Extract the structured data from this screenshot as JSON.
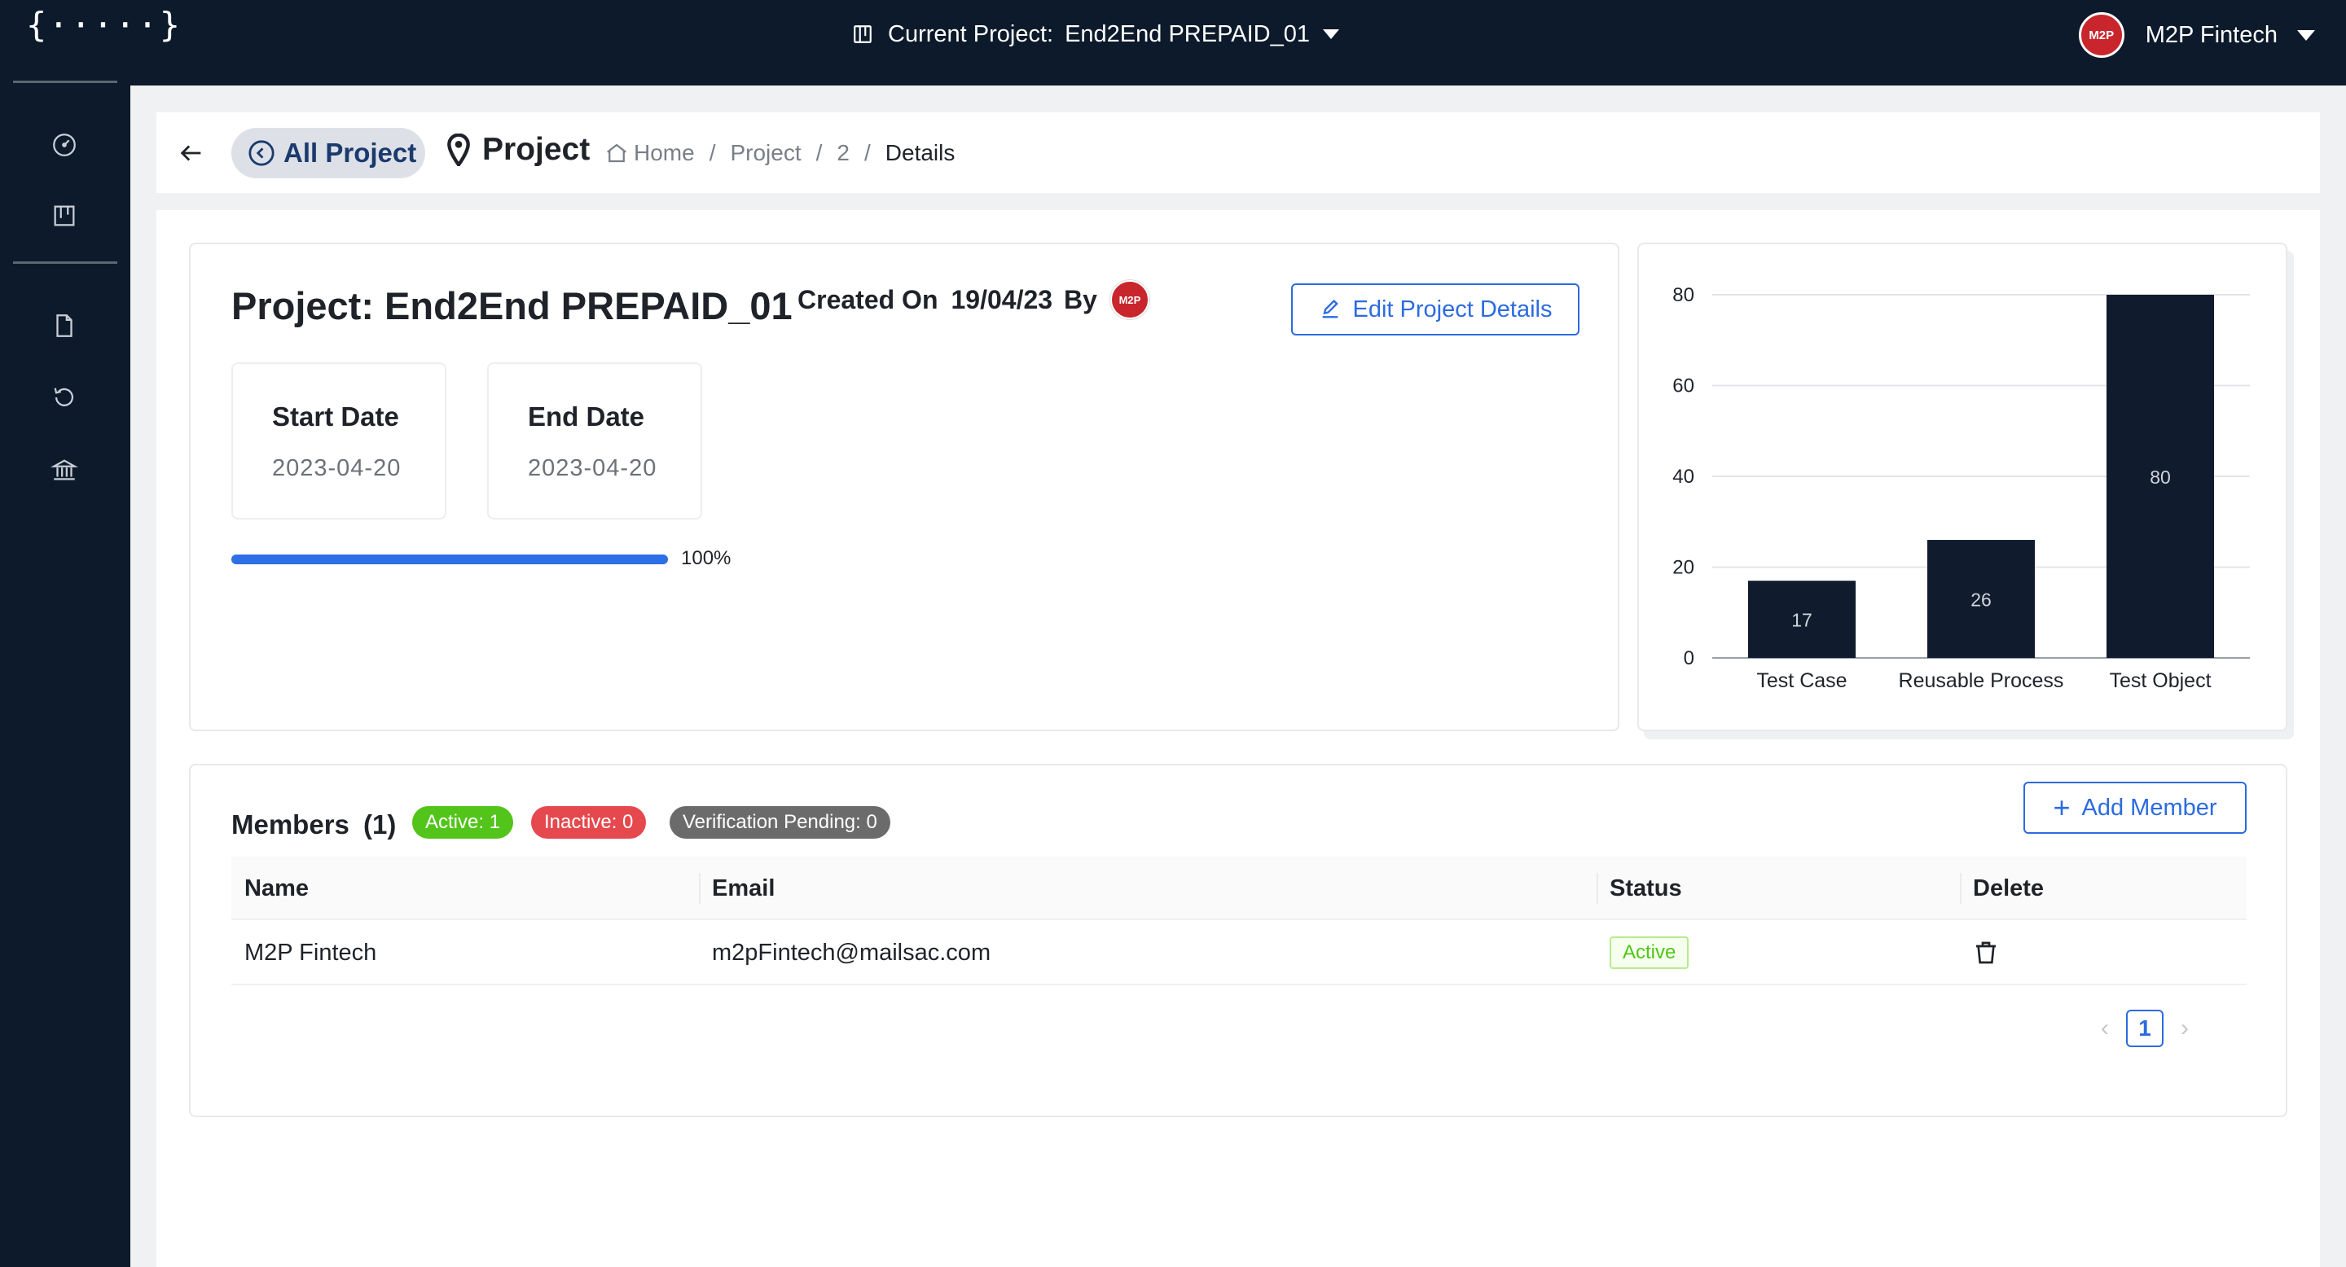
{
  "app": {
    "logo": "{·····}",
    "current_project_label": "Current Project:",
    "current_project_name": "End2End PREPAID_01",
    "user_name": "M2P Fintech",
    "avatar_text": "M2P"
  },
  "sidebar": {
    "items": [
      {
        "icon": "dashboard-icon"
      },
      {
        "icon": "board-icon"
      },
      {
        "icon": "document-icon"
      },
      {
        "icon": "history-icon"
      },
      {
        "icon": "bank-icon"
      }
    ]
  },
  "header": {
    "all_project_label": "All Project",
    "page_title": "Project",
    "breadcrumb": [
      "Home",
      "Project",
      "2",
      "Details"
    ]
  },
  "project": {
    "title": "Project: End2End PREPAID_01",
    "created_label": "Created On",
    "created_date": "19/04/23",
    "by_label": "By",
    "edit_label": "Edit Project Details",
    "start_label": "Start Date",
    "start_value": "2023-04-20",
    "end_label": "End Date",
    "end_value": "2023-04-20",
    "progress_percent": 100,
    "progress_text": "100%"
  },
  "chart_data": {
    "type": "bar",
    "categories": [
      "Test Case",
      "Reusable Process",
      "Test Object"
    ],
    "values": [
      17,
      26,
      80
    ],
    "data_labels": [
      "17",
      "26",
      "80"
    ],
    "ylim": [
      0,
      80
    ],
    "yticks": [
      "0",
      "20",
      "40",
      "60",
      "80"
    ],
    "bar_color": "#101c2e",
    "grid": true
  },
  "members": {
    "title": "Members",
    "count": "(1)",
    "badges": [
      {
        "text": "Active: 1",
        "color": "#52c41a"
      },
      {
        "text": "Inactive: 0",
        "color": "#e5484d"
      },
      {
        "text": "Verification Pending: 0",
        "color": "#6b6b6b"
      }
    ],
    "add_label": "Add Member",
    "columns": [
      "Name",
      "Email",
      "Status",
      "Delete"
    ],
    "rows": [
      {
        "name": "M2P Fintech",
        "email": "m2pFintech@mailsac.com",
        "status": "Active"
      }
    ],
    "page": "1"
  }
}
